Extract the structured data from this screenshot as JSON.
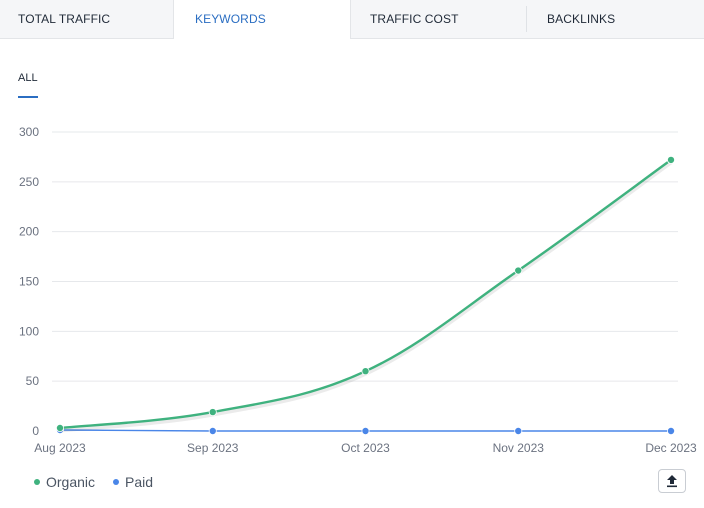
{
  "tabs": [
    {
      "label": "TOTAL TRAFFIC",
      "active": false
    },
    {
      "label": "KEYWORDS",
      "active": true
    },
    {
      "label": "TRAFFIC COST",
      "active": false
    },
    {
      "label": "BACKLINKS",
      "active": false
    }
  ],
  "subtab": {
    "label": "ALL"
  },
  "colors": {
    "organic": "#3fb27f",
    "paid": "#4a86e8",
    "accent": "#2b6ec2"
  },
  "export_button": {
    "icon": "upload-icon"
  },
  "chart_data": {
    "type": "line",
    "categories": [
      "Aug 2023",
      "Sep 2023",
      "Oct 2023",
      "Nov 2023",
      "Dec 2023"
    ],
    "series": [
      {
        "name": "Organic",
        "values": [
          3,
          19,
          60,
          161,
          272
        ]
      },
      {
        "name": "Paid",
        "values": [
          1,
          0,
          0,
          0,
          0
        ]
      }
    ],
    "yticks": [
      "0",
      "50",
      "100",
      "150",
      "200",
      "250",
      "300"
    ],
    "ylim": [
      0,
      300
    ],
    "grid": true,
    "legend_position": "bottom-left"
  }
}
